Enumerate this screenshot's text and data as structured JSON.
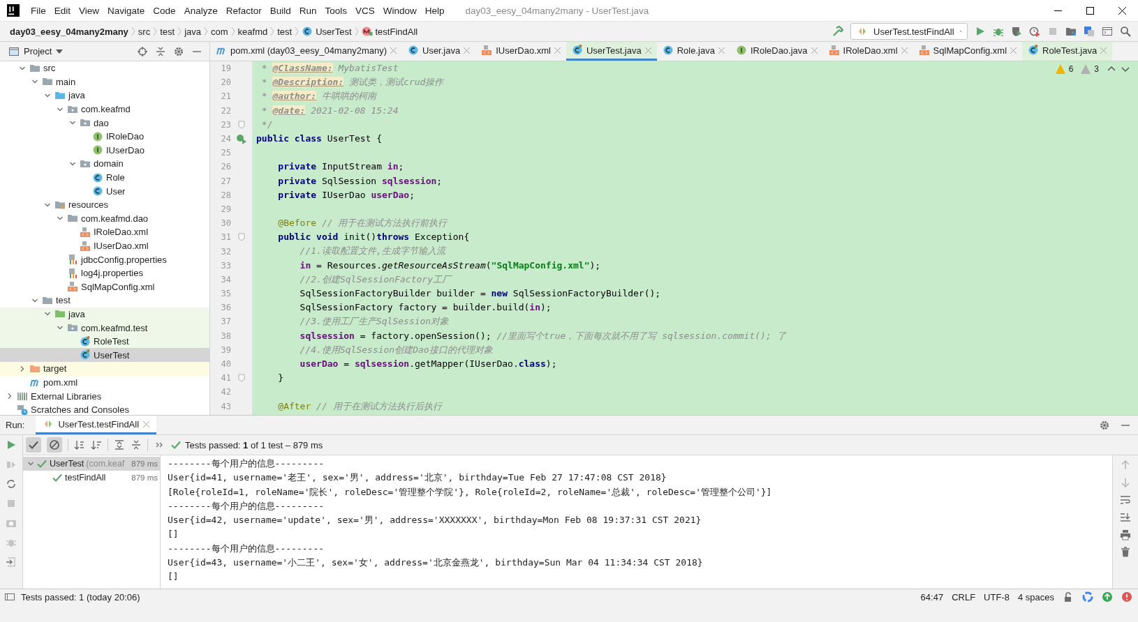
{
  "window": {
    "title": "day03_eesy_04many2many - UserTest.java"
  },
  "menu": [
    "File",
    "Edit",
    "View",
    "Navigate",
    "Code",
    "Analyze",
    "Refactor",
    "Build",
    "Run",
    "Tools",
    "VCS",
    "Window",
    "Help"
  ],
  "breadcrumbs": [
    {
      "label": "day03_eesy_04many2many",
      "kind": "project"
    },
    {
      "label": "src",
      "kind": "dir"
    },
    {
      "label": "test",
      "kind": "dir"
    },
    {
      "label": "java",
      "kind": "dir"
    },
    {
      "label": "com",
      "kind": "dir"
    },
    {
      "label": "keafmd",
      "kind": "dir"
    },
    {
      "label": "test",
      "kind": "dir"
    },
    {
      "label": "UserTest",
      "kind": "class"
    },
    {
      "label": "testFindAll",
      "kind": "method"
    }
  ],
  "run_config": "UserTest.testFindAll",
  "project": {
    "title": "Project",
    "tree": [
      {
        "label": "src",
        "kind": "folder",
        "expanded": true,
        "children": [
          {
            "label": "main",
            "kind": "folder",
            "expanded": true,
            "children": [
              {
                "label": "java",
                "kind": "source-root",
                "expanded": true,
                "children": [
                  {
                    "label": "com.keafmd",
                    "kind": "package",
                    "expanded": true,
                    "children": [
                      {
                        "label": "dao",
                        "kind": "package",
                        "expanded": true,
                        "children": [
                          {
                            "label": "IRoleDao",
                            "kind": "interface"
                          },
                          {
                            "label": "IUserDao",
                            "kind": "interface"
                          }
                        ]
                      },
                      {
                        "label": "domain",
                        "kind": "package",
                        "expanded": true,
                        "children": [
                          {
                            "label": "Role",
                            "kind": "class"
                          },
                          {
                            "label": "User",
                            "kind": "class"
                          }
                        ]
                      }
                    ]
                  }
                ]
              },
              {
                "label": "resources",
                "kind": "resources-root",
                "expanded": true,
                "children": [
                  {
                    "label": "com.keafmd.dao",
                    "kind": "folder",
                    "expanded": true,
                    "children": [
                      {
                        "label": "IRoleDao.xml",
                        "kind": "xml"
                      },
                      {
                        "label": "IUserDao.xml",
                        "kind": "xml"
                      }
                    ]
                  },
                  {
                    "label": "jdbcConfig.properties",
                    "kind": "properties"
                  },
                  {
                    "label": "log4j.properties",
                    "kind": "properties"
                  },
                  {
                    "label": "SqlMapConfig.xml",
                    "kind": "xml"
                  }
                ]
              }
            ]
          },
          {
            "label": "test",
            "kind": "folder",
            "expanded": true,
            "children": [
              {
                "label": "java",
                "kind": "test-root",
                "expanded": true,
                "test_scope": true,
                "children": [
                  {
                    "label": "com.keafmd.test",
                    "kind": "package",
                    "expanded": true,
                    "test_scope": true,
                    "children": [
                      {
                        "label": "RoleTest",
                        "kind": "test-class",
                        "test_scope": true,
                        "selected": false
                      },
                      {
                        "label": "UserTest",
                        "kind": "test-class",
                        "test_scope": true,
                        "selected": true
                      }
                    ]
                  }
                ]
              }
            ]
          }
        ]
      },
      {
        "label": "target",
        "kind": "excluded-folder",
        "expanded": false,
        "excluded": true
      },
      {
        "label": "pom.xml",
        "kind": "maven"
      }
    ],
    "other_items": [
      {
        "label": "External Libraries",
        "kind": "libraries",
        "expanded": false
      },
      {
        "label": "Scratches and Consoles",
        "kind": "scratches"
      }
    ]
  },
  "tabs": [
    {
      "label": "pom.xml (day03_eesy_04many2many)",
      "kind": "maven",
      "selected": false
    },
    {
      "label": "User.java",
      "kind": "class",
      "selected": false
    },
    {
      "label": "IUserDao.xml",
      "kind": "xml",
      "selected": false
    },
    {
      "label": "UserTest.java",
      "kind": "test-class",
      "selected": true,
      "test_scope": true
    },
    {
      "label": "Role.java",
      "kind": "class",
      "selected": false
    },
    {
      "label": "IRoleDao.java",
      "kind": "interface",
      "selected": false
    },
    {
      "label": "IRoleDao.xml",
      "kind": "xml",
      "selected": false
    },
    {
      "label": "SqlMapConfig.xml",
      "kind": "xml",
      "selected": false
    },
    {
      "label": "RoleTest.java",
      "kind": "test-class",
      "selected": false,
      "test_scope": true
    }
  ],
  "inspections": {
    "warnings": "6",
    "weak_warnings": "3"
  },
  "code": [
    {
      "n": "19",
      "spans": [
        {
          "kind": "doc",
          "t": " * "
        },
        {
          "kind": "doctag",
          "t": "@ClassName:"
        },
        {
          "kind": "doc",
          "t": " MybatisTest"
        }
      ]
    },
    {
      "n": "20",
      "spans": [
        {
          "kind": "doc",
          "t": " * "
        },
        {
          "kind": "doctag",
          "t": "@Description:"
        },
        {
          "kind": "doc",
          "t": " 测试类，测试crud操作"
        }
      ]
    },
    {
      "n": "21",
      "spans": [
        {
          "kind": "doc",
          "t": " * "
        },
        {
          "kind": "doctag",
          "t": "@author:"
        },
        {
          "kind": "doc",
          "t": " 牛哄哄的柯南"
        }
      ]
    },
    {
      "n": "22",
      "spans": [
        {
          "kind": "doc",
          "t": " * "
        },
        {
          "kind": "doctag",
          "t": "@date:"
        },
        {
          "kind": "doc",
          "t": " 2021-02-08 15:24"
        }
      ]
    },
    {
      "n": "23",
      "foldable": true,
      "spans": [
        {
          "kind": "doc",
          "t": " */"
        }
      ]
    },
    {
      "n": "24",
      "runnable": true,
      "spans": [
        {
          "kind": "kw",
          "t": "public class"
        },
        {
          "kind": "plain",
          "t": " UserTest {"
        }
      ]
    },
    {
      "n": "25"
    },
    {
      "n": "26",
      "spans": [
        {
          "kind": "kw",
          "t": "    private"
        },
        {
          "kind": "plain",
          "t": " InputStream "
        },
        {
          "kind": "field",
          "t": "in"
        },
        {
          "kind": "plain",
          "t": ";"
        }
      ]
    },
    {
      "n": "27",
      "spans": [
        {
          "kind": "kw",
          "t": "    private"
        },
        {
          "kind": "plain",
          "t": " SqlSession "
        },
        {
          "kind": "field",
          "t": "sqlsession"
        },
        {
          "kind": "plain",
          "t": ";"
        }
      ]
    },
    {
      "n": "28",
      "spans": [
        {
          "kind": "kw",
          "t": "    private"
        },
        {
          "kind": "plain",
          "t": " IUserDao "
        },
        {
          "kind": "field",
          "t": "userDao"
        },
        {
          "kind": "plain",
          "t": ";"
        }
      ]
    },
    {
      "n": "29"
    },
    {
      "n": "30",
      "spans": [
        {
          "kind": "anno",
          "t": "    @Before"
        },
        {
          "kind": "comment",
          "t": " // 用于在测试方法执行前执行"
        }
      ]
    },
    {
      "n": "31",
      "foldable": true,
      "spans": [
        {
          "kind": "kw",
          "t": "    public void"
        },
        {
          "kind": "plain",
          "t": " init()"
        },
        {
          "kind": "kw",
          "t": "throws"
        },
        {
          "kind": "plain",
          "t": " Exception{"
        }
      ]
    },
    {
      "n": "32",
      "spans": [
        {
          "kind": "comment",
          "t": "        //1.读取配置文件,生成字节输入流"
        }
      ]
    },
    {
      "n": "33",
      "spans": [
        {
          "kind": "field",
          "t": "        in"
        },
        {
          "kind": "plain",
          "t": " = Resources."
        },
        {
          "kind": "static",
          "t": "getResourceAsStream"
        },
        {
          "kind": "plain",
          "t": "("
        },
        {
          "kind": "string",
          "t": "\"SqlMapConfig.xml\""
        },
        {
          "kind": "plain",
          "t": ");"
        }
      ]
    },
    {
      "n": "34",
      "spans": [
        {
          "kind": "comment",
          "t": "        //2.创建SqlSessionFactory工厂"
        }
      ]
    },
    {
      "n": "35",
      "spans": [
        {
          "kind": "plain",
          "t": "        SqlSessionFactoryBuilder builder = "
        },
        {
          "kind": "kw",
          "t": "new"
        },
        {
          "kind": "plain",
          "t": " SqlSessionFactoryBuilder();"
        }
      ]
    },
    {
      "n": "36",
      "spans": [
        {
          "kind": "plain",
          "t": "        SqlSessionFactory factory = builder.build("
        },
        {
          "kind": "field",
          "t": "in"
        },
        {
          "kind": "plain",
          "t": ");"
        }
      ]
    },
    {
      "n": "37",
      "spans": [
        {
          "kind": "comment",
          "t": "        //3.使用工厂生产SqlSession对象"
        }
      ]
    },
    {
      "n": "38",
      "spans": [
        {
          "kind": "field",
          "t": "        sqlsession"
        },
        {
          "kind": "plain",
          "t": " = factory.openSession(); "
        },
        {
          "kind": "comment",
          "t": "//里面写个true，下面每次就不用了写 sqlsession.commit(); 了"
        }
      ]
    },
    {
      "n": "39",
      "spans": [
        {
          "kind": "comment",
          "t": "        //4.使用SqlSession创建Dao接口的代理对象"
        }
      ]
    },
    {
      "n": "40",
      "spans": [
        {
          "kind": "field",
          "t": "        userDao"
        },
        {
          "kind": "plain",
          "t": " = "
        },
        {
          "kind": "field",
          "t": "sqlsession"
        },
        {
          "kind": "plain",
          "t": ".getMapper(IUserDao."
        },
        {
          "kind": "kw",
          "t": "class"
        },
        {
          "kind": "plain",
          "t": ");"
        }
      ]
    },
    {
      "n": "41",
      "foldable": true,
      "spans": [
        {
          "kind": "plain",
          "t": "    }"
        }
      ]
    },
    {
      "n": "42"
    },
    {
      "n": "43",
      "spans": [
        {
          "kind": "anno",
          "t": "    @After"
        },
        {
          "kind": "comment",
          "t": " // 用于在测试方法执行后执行"
        }
      ]
    }
  ],
  "run": {
    "label": "Run:",
    "tab": "UserTest.testFindAll",
    "toggles": [
      {
        "kind": "passed",
        "on": true
      },
      {
        "kind": "ignored",
        "on": true
      }
    ],
    "summary": "Tests passed: **1** of 1 test – 879 ms",
    "tests": [
      {
        "name": "UserTest",
        "detail": "(com.keaf",
        "time": "879 ms",
        "passed": true,
        "selected": true,
        "children": [
          {
            "name": "testFindAll",
            "time": "879 ms",
            "passed": true,
            "selected": false
          }
        ]
      }
    ],
    "console": [
      "--------每个用户的信息---------",
      "User{id=41, username='老王', sex='男', address='北京', birthday=Tue Feb 27 17:47:08 CST 2018}",
      "[Role{roleId=1, roleName='院长', roleDesc='管理整个学院'}, Role{roleId=2, roleName='总裁', roleDesc='管理整个公司'}]",
      "--------每个用户的信息---------",
      "User{id=42, username='update', sex='男', address='XXXXXXX', birthday=Mon Feb 08 19:37:31 CST 2021}",
      "[]",
      "--------每个用户的信息---------",
      "User{id=43, username='小二王', sex='女', address='北京金燕龙', birthday=Sun Mar 04 11:34:34 CST 2018}",
      "[]"
    ]
  },
  "status_bar": {
    "message": "Tests passed: 1 (today 20:06)",
    "position": "64:47",
    "line_separator": "CRLF",
    "encoding": "UTF-8",
    "indent": "4 spaces"
  }
}
